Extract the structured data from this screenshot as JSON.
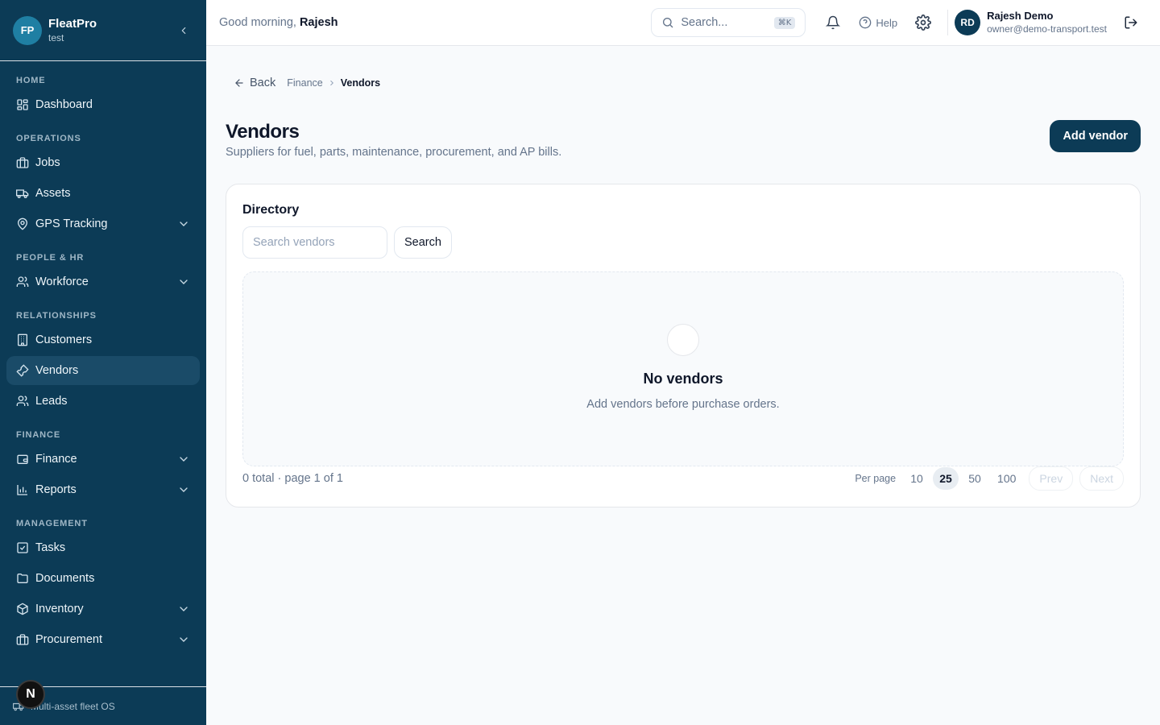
{
  "brand": {
    "initials": "FP",
    "name": "FleatPro",
    "sub": "test"
  },
  "sidebar": {
    "sections": {
      "home": "HOME",
      "operations": "OPERATIONS",
      "people": "PEOPLE & HR",
      "relationships": "RELATIONSHIPS",
      "finance": "FINANCE",
      "management": "MANAGEMENT"
    },
    "items": {
      "dashboard": "Dashboard",
      "jobs": "Jobs",
      "assets": "Assets",
      "gps": "GPS Tracking",
      "workforce": "Workforce",
      "customers": "Customers",
      "vendors": "Vendors",
      "leads": "Leads",
      "finance": "Finance",
      "reports": "Reports",
      "tasks": "Tasks",
      "documents": "Documents",
      "inventory": "Inventory",
      "procurement": "Procurement"
    },
    "active": "Vendors",
    "footer": "Multi-asset fleet OS",
    "badge": "N"
  },
  "header": {
    "greeting_prefix": "Good morning,",
    "greeting_name": "Rajesh",
    "search_placeholder": "Search...",
    "search_shortcut": "⌘K",
    "help": "Help",
    "user": {
      "initials": "RD",
      "name": "Rajesh Demo",
      "email": "owner@demo-transport.test"
    }
  },
  "breadcrumb": {
    "back": "Back",
    "parent": "Finance",
    "current": "Vendors"
  },
  "page": {
    "title": "Vendors",
    "subtitle": "Suppliers for fuel, parts, maintenance, procurement, and AP bills.",
    "add_button": "Add vendor"
  },
  "directory": {
    "title": "Directory",
    "search_placeholder": "Search vendors",
    "search_value": "",
    "search_button": "Search",
    "empty_title": "No vendors",
    "empty_subtitle": "Add vendors before purchase orders."
  },
  "pagination": {
    "summary": "0 total · page 1 of 1",
    "per_page_label": "Per page",
    "options": [
      "10",
      "25",
      "50",
      "100"
    ],
    "selected": "25",
    "prev": "Prev",
    "next": "Next"
  },
  "colors": {
    "sidebar": "#0c3b56",
    "accent": "#0c3b56",
    "active_item": "#1a4b68"
  }
}
